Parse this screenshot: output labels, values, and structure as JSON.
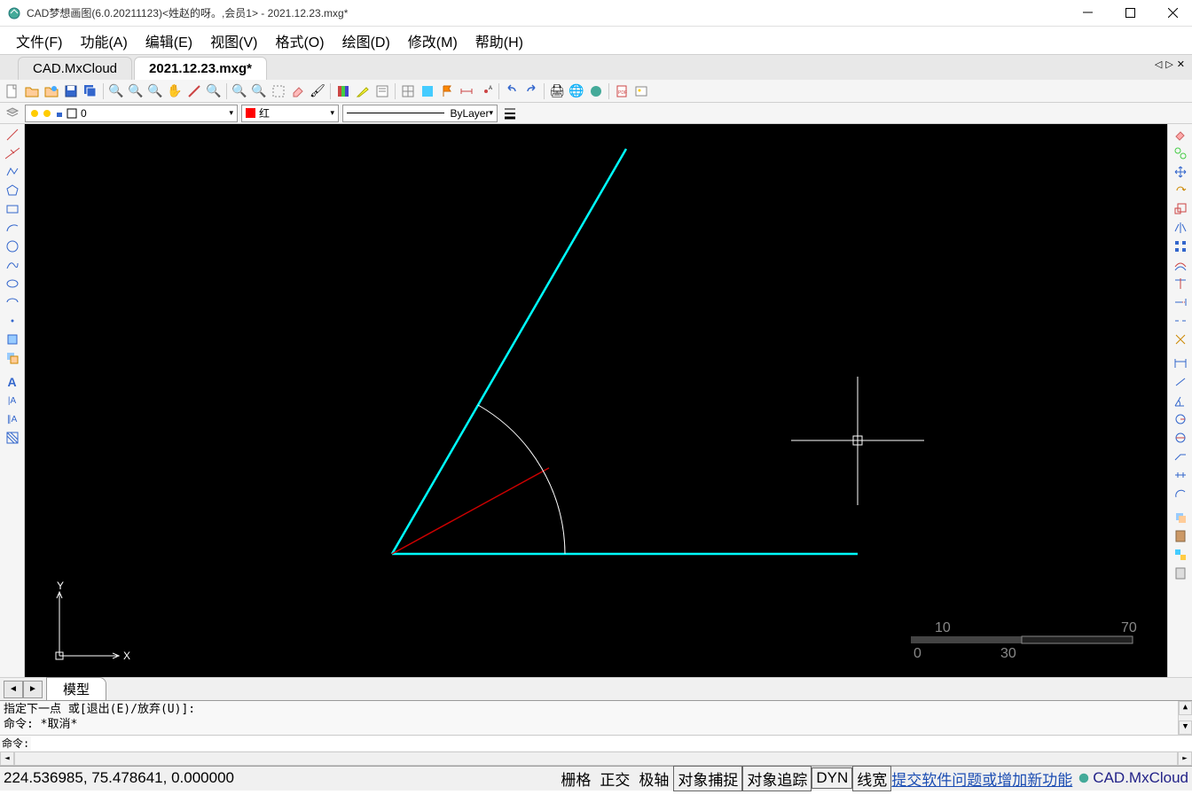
{
  "title": "CAD梦想画图(6.0.20211123)<姓赵的呀。,会员1> - 2021.12.23.mxg*",
  "menu": [
    "文件(F)",
    "功能(A)",
    "编辑(E)",
    "视图(V)",
    "格式(O)",
    "绘图(D)",
    "修改(M)",
    "帮助(H)"
  ],
  "tabs": [
    {
      "label": "CAD.MxCloud",
      "active": false
    },
    {
      "label": "2021.12.23.mxg*",
      "active": true
    }
  ],
  "layer": {
    "name": "0"
  },
  "color": {
    "name": "红",
    "hex": "#ff0000"
  },
  "linetype": {
    "name": "ByLayer"
  },
  "model_tab": "模型",
  "ruler": {
    "left": "10",
    "right": "70",
    "zero": "0",
    "mid": "30"
  },
  "command": {
    "line1": "指定下一点 或[退出(E)/放弃(U)]:",
    "line2": "命令:  *取消*",
    "prompt": "命令:"
  },
  "status": {
    "coords": "224.536985,  75.478641,  0.000000",
    "buttons": [
      "栅格",
      "正交",
      "极轴",
      "对象捕捉",
      "对象追踪",
      "DYN",
      "线宽"
    ],
    "boxed": [
      false,
      false,
      false,
      true,
      true,
      true,
      true
    ],
    "link": "提交软件问题或增加新功能",
    "brand": "CAD.MxCloud"
  },
  "ucs_label_y": "Y",
  "ucs_label_x": "X"
}
